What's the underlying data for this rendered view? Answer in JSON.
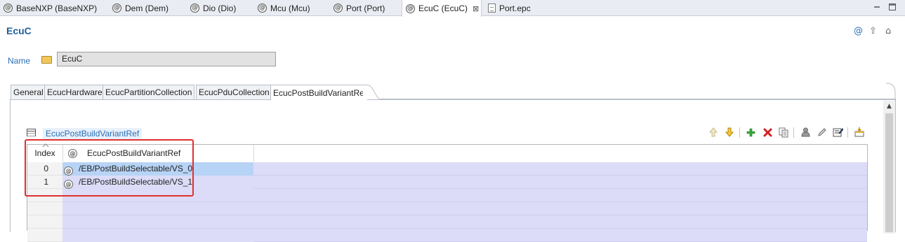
{
  "editor_tabs": [
    {
      "label": "BaseNXP (BaseNXP)",
      "icon": "module-icon"
    },
    {
      "label": "Dem (Dem)",
      "icon": "module-icon"
    },
    {
      "label": "Dio (Dio)",
      "icon": "module-icon"
    },
    {
      "label": "Mcu (Mcu)",
      "icon": "module-icon"
    },
    {
      "label": "Port (Port)",
      "icon": "module-icon"
    },
    {
      "label": "EcuC (EcuC)",
      "icon": "module-icon",
      "active": true,
      "close": "⊠"
    },
    {
      "label": "Port.epc",
      "icon": "document-icon"
    }
  ],
  "header": {
    "title": "EcuC",
    "icon_glyphs": {
      "at": "@",
      "up": "⇧",
      "home": "⌂"
    }
  },
  "name_field": {
    "label": "Name",
    "value": "EcuC"
  },
  "sub_tabs": [
    {
      "label": "General"
    },
    {
      "label": "EcucHardware"
    },
    {
      "label": "EcucPartitionCollection"
    },
    {
      "label": "EcucPduCollection"
    },
    {
      "label": "EcucPostBuildVariantRef",
      "active": true
    }
  ],
  "section": {
    "title": "EcucPostBuildVariantRef"
  },
  "toolbar_icons": [
    "move-up-icon",
    "move-down-icon",
    "add-icon",
    "delete-icon",
    "copy-icon",
    "user-icon",
    "edit-icon",
    "edit-all-icon",
    "insert-icon"
  ],
  "table": {
    "columns": {
      "index": "Index",
      "ref": "EcucPostBuildVariantRef",
      "ref_icon": "@"
    },
    "rows": [
      {
        "index": "0",
        "value": "/EB/PostBuildSelectable/VS_0",
        "selected": true
      },
      {
        "index": "1",
        "value": "/EB/PostBuildSelectable/VS_1",
        "selected": false
      }
    ],
    "empty_rows": 4
  },
  "colors": {
    "accent": "#2a6fb3",
    "title": "#1f5fa0",
    "selection": "#b7d3f5",
    "row_fill": "#dcdcf8",
    "highlight_box": "#e03030"
  }
}
